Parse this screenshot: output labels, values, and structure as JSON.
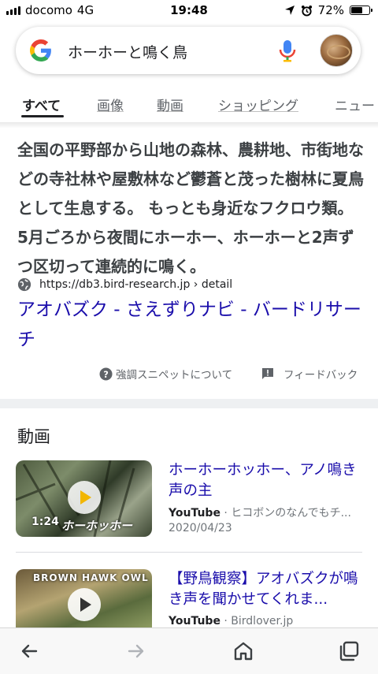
{
  "status_bar": {
    "carrier": "docomo",
    "network": "4G",
    "time": "19:48",
    "battery": "72%",
    "battery_level": 0.72
  },
  "search": {
    "query": "ホーホーと鳴く鳥"
  },
  "tabs": [
    {
      "label": "すべて",
      "active": true
    },
    {
      "label": "画像"
    },
    {
      "label": "動画"
    },
    {
      "label": "ショッピング"
    },
    {
      "label": "ニュー"
    }
  ],
  "featured_snippet": {
    "text": "全国の平野部から山地の森林、農耕地、市街地などの寺社林や屋敷林など鬱蒼と茂った樹林に夏鳥として生息する。 もっとも身近なフクロウ類。 5月ごろから夜間にホーホー、ホーホーと2声ずつ区切って連続的に鳴く。",
    "source_url": "https://db3.bird-research.jp › detail",
    "title": "アオバズク - さえずりナビ - バードリサーチ",
    "about_label": "強調スニペットについて",
    "feedback_label": "フィードバック"
  },
  "videos_section": {
    "title": "動画",
    "items": [
      {
        "title": "ホーホーホッホー、アノ鳴き声の主",
        "source": "YouTube",
        "channel": "· ヒコボンのなんでもチ...",
        "date": "2020/04/23",
        "duration": "1:24",
        "thumb_caption": "ホーホッホー"
      },
      {
        "title": "【野鳥観察】アオバズクが鳴き声を聞かせてくれま...",
        "source": "YouTube",
        "channel": "· Birdlover.jp",
        "thumb_caption": "BROWN HAWK OWL"
      }
    ]
  },
  "colors": {
    "link": "#1a0dab",
    "text": "#202124",
    "meta": "#70757a"
  }
}
